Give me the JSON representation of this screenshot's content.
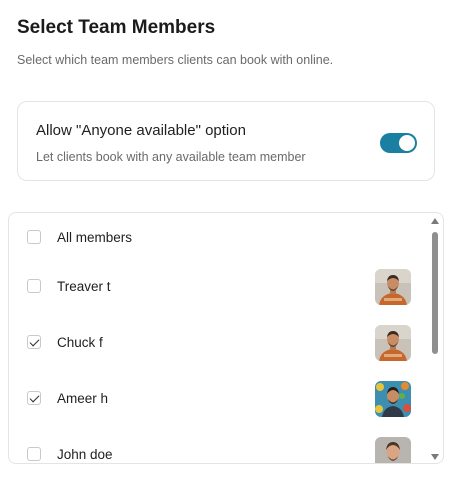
{
  "header": {
    "title": "Select Team Members",
    "subtitle": "Select which team members clients can book with online."
  },
  "anyone_option": {
    "title": "Allow \"Anyone available\" option",
    "description": "Let clients book with any available team member",
    "enabled": true,
    "accent_color": "#1a7fa0"
  },
  "members": {
    "all_label": "All members",
    "all_checked": false,
    "items": [
      {
        "name": "Treaver t",
        "checked": false,
        "avatar": "man-orange-shirt-avatar"
      },
      {
        "name": "Chuck f",
        "checked": true,
        "avatar": "man-orange-shirt-avatar"
      },
      {
        "name": "Ameer h",
        "checked": true,
        "avatar": "man-floral-background-avatar"
      },
      {
        "name": "John doe",
        "checked": false,
        "avatar": "man-gray-background-avatar"
      }
    ]
  }
}
